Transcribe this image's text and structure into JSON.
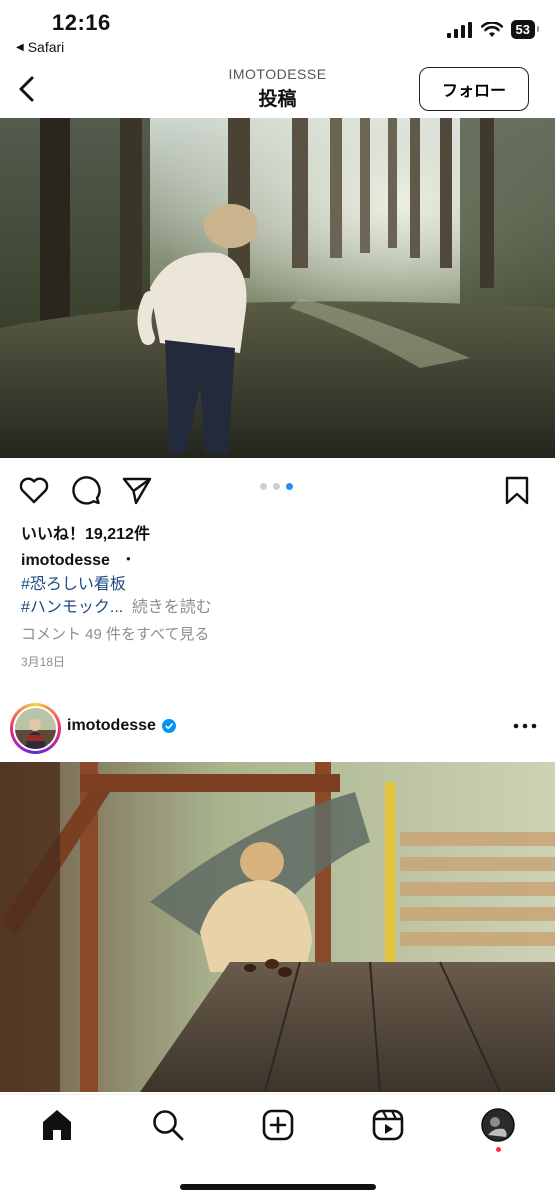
{
  "status_bar": {
    "time": "12:16",
    "back_app": "Safari",
    "battery": "53"
  },
  "nav": {
    "account": "IMOTODESSE",
    "title": "投稿",
    "follow_label": "フォロー"
  },
  "post1": {
    "carousel_total": 3,
    "carousel_active_index": 2,
    "likes": "いいね！19,212件",
    "username": "imotodesse",
    "separator": "・",
    "hashtag1": "#恐ろしい看板",
    "hashtag2": "#ハンモック...",
    "more_label": "続きを読む",
    "comments_link": "コメント 49 件をすべて見る",
    "date": "3月18日"
  },
  "post2": {
    "username": "imotodesse",
    "verified": true
  },
  "icons": {
    "back": "chevron-left-icon",
    "like": "heart-icon",
    "comment": "comment-icon",
    "share": "send-icon",
    "save": "bookmark-icon",
    "more": "more-icon",
    "home": "home-icon",
    "search": "search-icon",
    "create": "plus-square-icon",
    "reels": "reels-icon",
    "profile": "profile-avatar"
  },
  "colors": {
    "hashtag": "#1d4a80",
    "active_dot": "#2d8cf0",
    "verified": "#0095f6",
    "notification": "#ff3040"
  }
}
